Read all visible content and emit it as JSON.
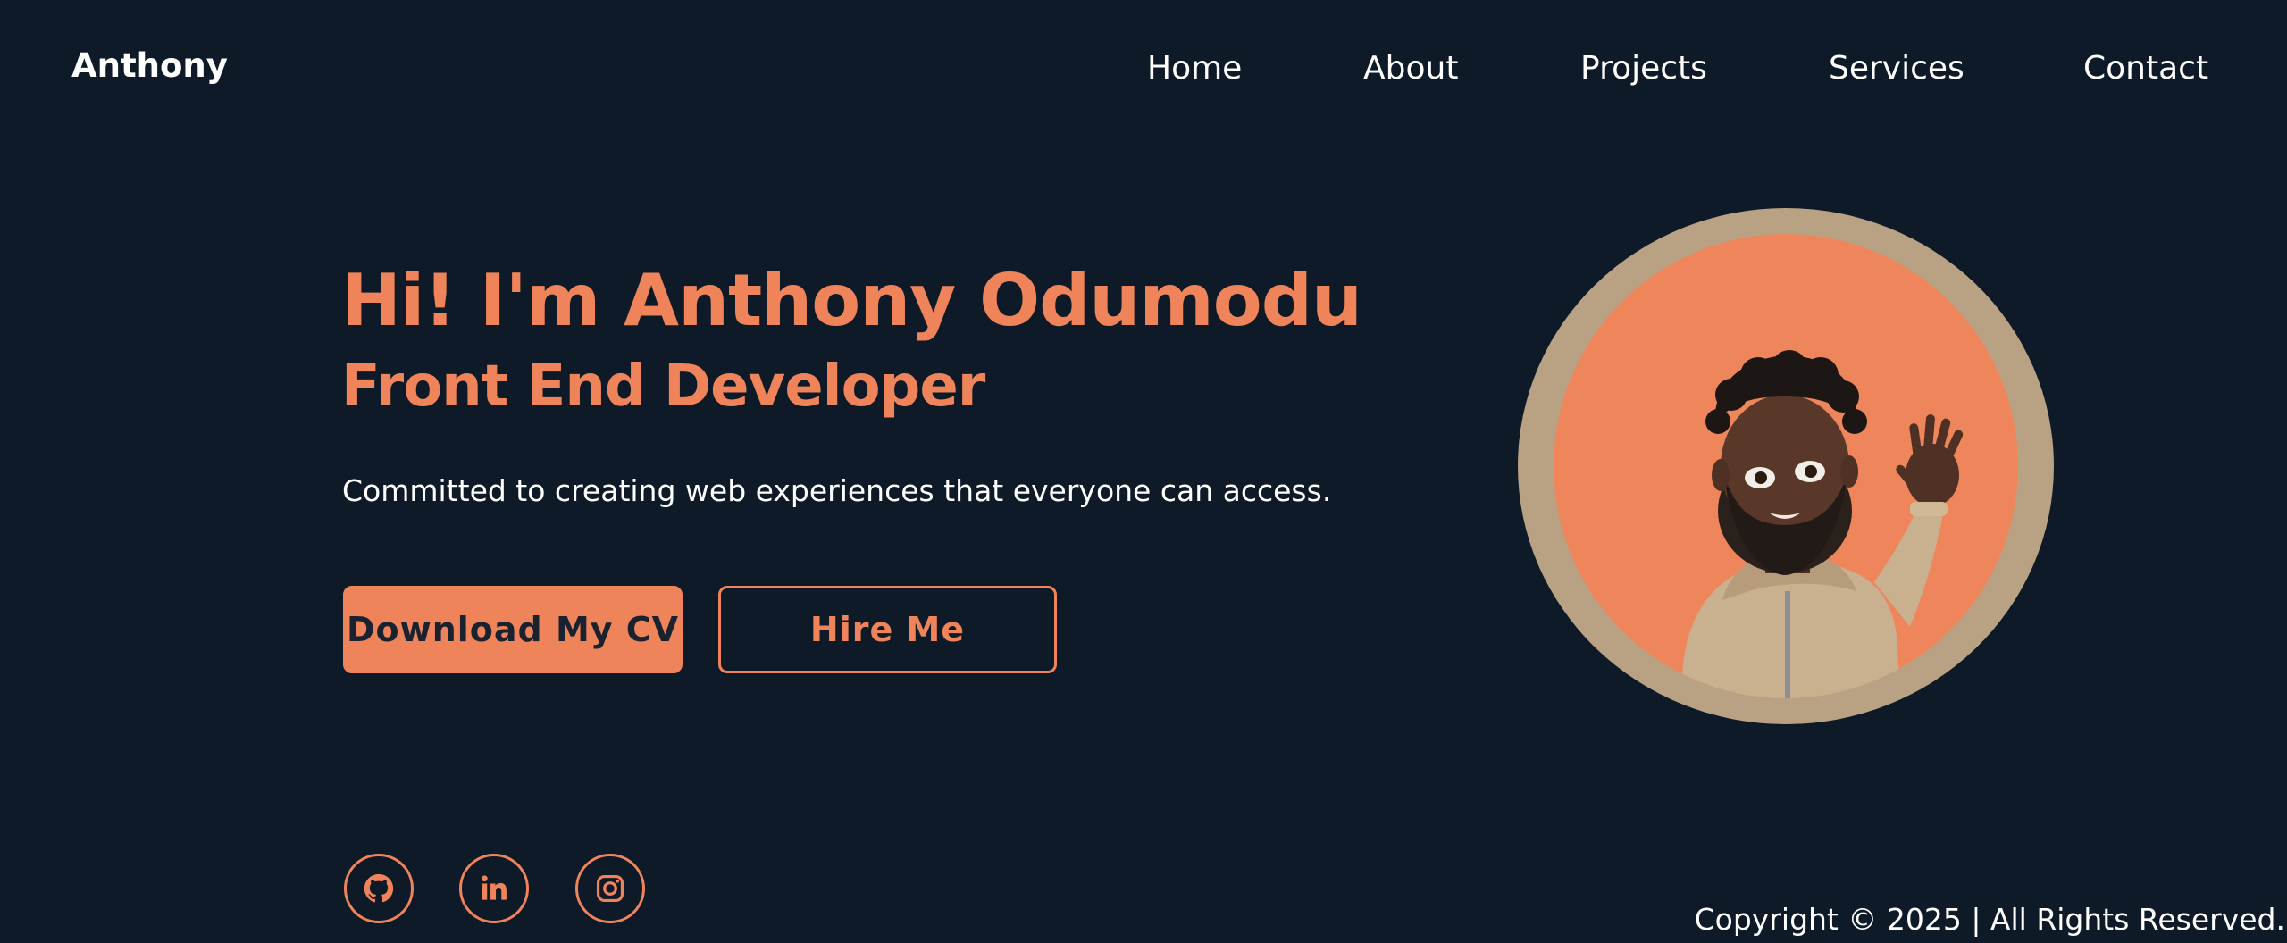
{
  "header": {
    "logo": "Anthony",
    "nav": {
      "home": "Home",
      "about": "About",
      "projects": "Projects",
      "services": "Services",
      "contact": "Contact"
    }
  },
  "hero": {
    "title": "Hi! I'm Anthony Odumodu",
    "subtitle": "Front End Developer",
    "description": "Committed to creating web experiences that everyone can access.",
    "buttons": {
      "download_cv": "Download My CV",
      "hire_me": "Hire Me"
    }
  },
  "social": {
    "icons": [
      "github-icon",
      "linkedin-icon",
      "instagram-icon"
    ]
  },
  "footer": {
    "copyright": "Copyright © 2025 | All Rights Reserved."
  },
  "colors": {
    "background": "#0e1a27",
    "accent": "#ef845a",
    "avatar_ring": "#b9a184",
    "text": "#ffffff"
  }
}
